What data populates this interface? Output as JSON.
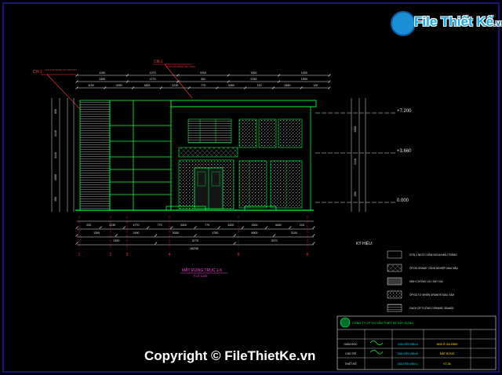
{
  "watermark": {
    "logo_text": "File Thiết Kế",
    "logo_domain": ".vn",
    "copyright": "Copyright © FileThietKe.vn"
  },
  "drawing": {
    "callouts": {
      "ch1": "CH-1",
      "ch1_note": "LAN CAN BẢNG GỖ SƠN PU",
      "ch2": "CH-2",
      "ch2_note": "LAN CAN BẢNG SẮT SƠN"
    },
    "top_dims_row1": [
      "1150",
      "1270",
      "9300",
      "1500",
      "1000"
    ],
    "top_dims_row2": [
      "2450",
      "4770",
      "281",
      "5780",
      "1900"
    ],
    "top_dims_row3": [
      "1190",
      "2250",
      "1800",
      "2230",
      "770",
      "3450",
      "120",
      "3450",
      "120"
    ],
    "bottom_dims_row1": [
      "220",
      "2230",
      "4770",
      "770",
      "3420",
      "770",
      "3420",
      "1500",
      "3450",
      "120"
    ],
    "bottom_dims_row2": [
      "1390",
      "2490",
      "9300",
      "1700",
      "6900",
      "3100"
    ],
    "bottom_dims_row3": [
      "2490",
      "5770",
      "3070"
    ],
    "bottom_total": "18230",
    "grid_axes": [
      "1",
      "2",
      "3",
      "4",
      "5",
      "6"
    ],
    "left_dims": [
      "600",
      "2240",
      "3440",
      "2600",
      "450"
    ],
    "right_dims": [
      "3200",
      "2440",
      "450"
    ],
    "levels": [
      "+7.200",
      "+3.660",
      "0.000"
    ],
    "title": "MẶT ĐỨNG TRỤC 1-6",
    "scale": "TỈ LỆ 1/100"
  },
  "legend": {
    "heading": "KÝ HIỆU:",
    "items": [
      "SƠN 2 NƯỚC KIỂM NGOẠI MẦU TRẮNG",
      "ỐP ĐÁ GRANIT CÔNG NGHIỆP MÀU NÂU",
      "KÍNH CƯỜNG LỰC DÀY 10LI",
      "ỐP ĐÁ TỰ NHIÊN GRANITE MÀU XÁM",
      "GẠCH ỐP TƯỜNG CERAMIC 300x600"
    ]
  },
  "title_block": {
    "company": "CÔNG TY CP TƯ VẤN THIẾT KẾ XÂY DỰNG",
    "rows": [
      [
        "GIÁM ĐỐC",
        "NGUYỄN VĂN A",
        "NHÀ Ở GIA ĐÌNH"
      ],
      [
        "CHỦ TRÌ",
        "NGUYỄN VĂN B",
        "MẶT ĐỨNG"
      ],
      [
        "THIẾT KẾ",
        "NGUYỄN VĂN C",
        "KT-05"
      ]
    ]
  },
  "colors": {
    "background": "#000000",
    "frame": "#2323c8",
    "wall_green": "#00ff3c",
    "dim_white": "#e6e6e6",
    "axis_red": "#ff3030",
    "dim_red": "#ff3b3b",
    "pattern_grey": "#8c8c8c",
    "text_yellow": "#ffe000",
    "text_magenta": "#ff3ce0",
    "text_cyan": "#00e0ff"
  }
}
